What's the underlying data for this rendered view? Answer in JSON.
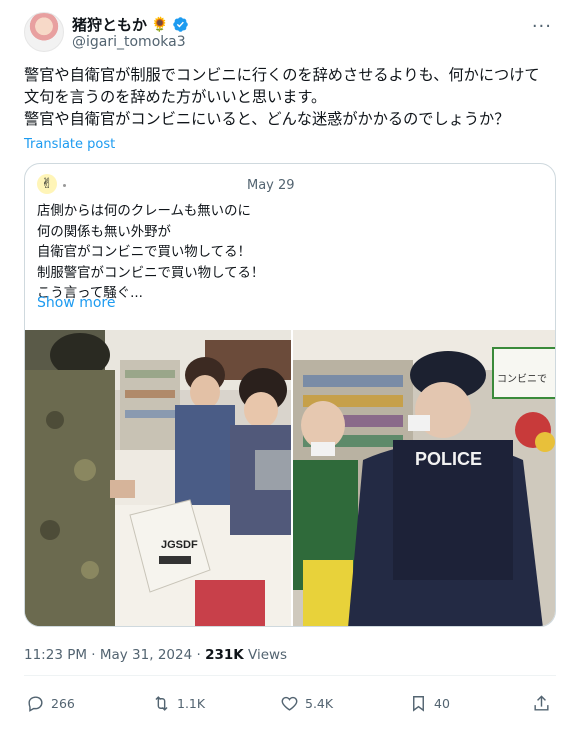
{
  "author": {
    "name": "猪狩ともか",
    "emoji": "🌻",
    "handle": "@igari_tomoka3"
  },
  "tweet": {
    "text": "警官や自衛官が制服でコンビニに行くのを辞めさせるよりも、何かにつけて文句を言うのを辞めた方がいいと思います。\n警官や自衛官がコンビニにいると、どんな迷惑がかかるのでしょうか？",
    "translate_label": "Translate post"
  },
  "quoted": {
    "date": "May 29",
    "text": "店側からは何のクレームも無いのに\n何の関係も無い外野が\n自衛官がコンビニで買い物してる！\n制服警官がコンビニで買い物してる！\nこう言って騒ぐ...",
    "show_more": "Show more",
    "photo1": {
      "bag_text": "JGSDF"
    },
    "photo2": {
      "vest_text": "POLICE",
      "sign_text": "コンビニで"
    }
  },
  "meta": {
    "time": "11:23 PM · May 31, 2024 · ",
    "views_count": "231K",
    "views_label": " Views"
  },
  "actions": {
    "replies": "266",
    "reposts": "1.1K",
    "likes": "5.4K",
    "bookmarks": "40"
  },
  "colors": {
    "accent": "#1d9bf0",
    "secondary_text": "#536471",
    "border": "#cfd9de"
  }
}
